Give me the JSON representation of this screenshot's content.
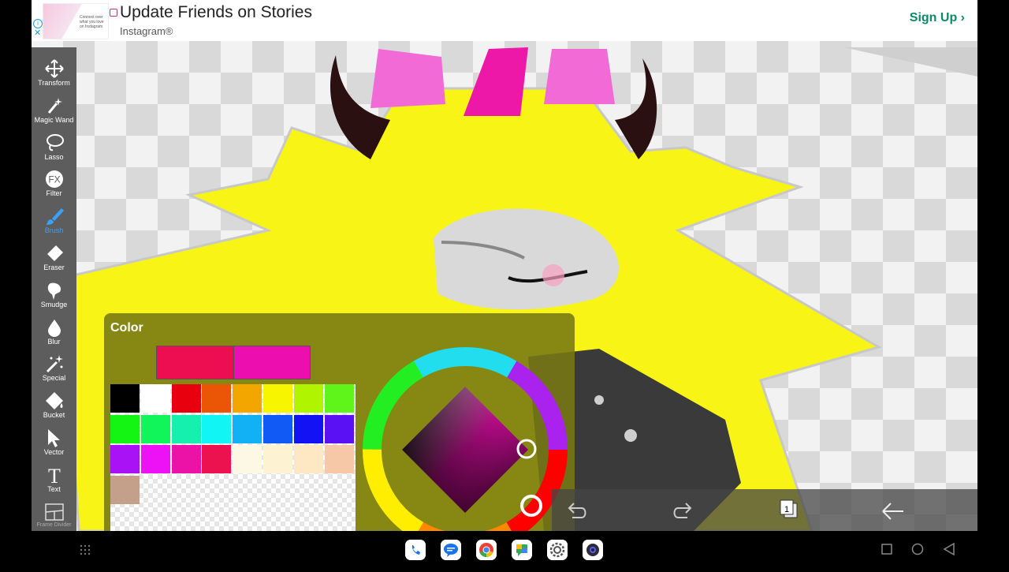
{
  "ad": {
    "title": "Update Friends on Stories",
    "sponsor": "Instagram®",
    "cta": "Sign Up",
    "cta_arrow": "›",
    "thumb_text": "Connect over what you love on Instagram",
    "info_glyph": "i",
    "close_glyph": "✕"
  },
  "toolbar": {
    "tools": [
      {
        "label": "Transform",
        "icon": "move-icon"
      },
      {
        "label": "Magic Wand",
        "icon": "magic-wand-icon"
      },
      {
        "label": "Lasso",
        "icon": "lasso-icon"
      },
      {
        "label": "Filter",
        "icon": "fx-icon",
        "glyph": "FX"
      },
      {
        "label": "Brush",
        "icon": "brush-icon",
        "active": true
      },
      {
        "label": "Eraser",
        "icon": "eraser-icon"
      },
      {
        "label": "Smudge",
        "icon": "smudge-icon"
      },
      {
        "label": "Blur",
        "icon": "blur-drop-icon"
      },
      {
        "label": "Special",
        "icon": "special-icon"
      },
      {
        "label": "Bucket",
        "icon": "bucket-icon"
      },
      {
        "label": "Vector",
        "icon": "vector-arrow-icon"
      },
      {
        "label": "Text",
        "icon": "text-icon",
        "glyph": "T"
      },
      {
        "label": "Frame Divider",
        "icon": "frame-divider-icon"
      }
    ],
    "active_color": "#3aa0ff"
  },
  "color_panel": {
    "title": "Color",
    "primary_color": "#ec0e50",
    "secondary_color": "#ec0eae",
    "swatches": [
      "#000000",
      "#ffffff",
      "#e8000e",
      "#ea5506",
      "#f4a600",
      "#f7f600",
      "#b0f400",
      "#5ff51a",
      "#14f514",
      "#12f55a",
      "#15f0ae",
      "#12f5f5",
      "#12b0f5",
      "#125af5",
      "#1212f5",
      "#5a12f5",
      "#a812f5",
      "#ec12f5",
      "#ec12a8",
      "#ec1250",
      "#fdf7e5",
      "#fdf2d2",
      "#fde8c3",
      "#f7c8a8",
      "#c4a08a"
    ]
  },
  "bottom_bar": {
    "undo_icon": "undo-icon",
    "redo_icon": "redo-icon",
    "layers_count": "1",
    "back_icon": "back-arrow-icon"
  },
  "navbar": {
    "apps": [
      "phone-icon",
      "messages-icon",
      "chrome-icon",
      "chat-icon",
      "settings-icon",
      "camera-icon"
    ],
    "left_icon": "app-drawer-icon",
    "right_icons": [
      "recents-icon",
      "home-icon",
      "back-icon"
    ]
  }
}
